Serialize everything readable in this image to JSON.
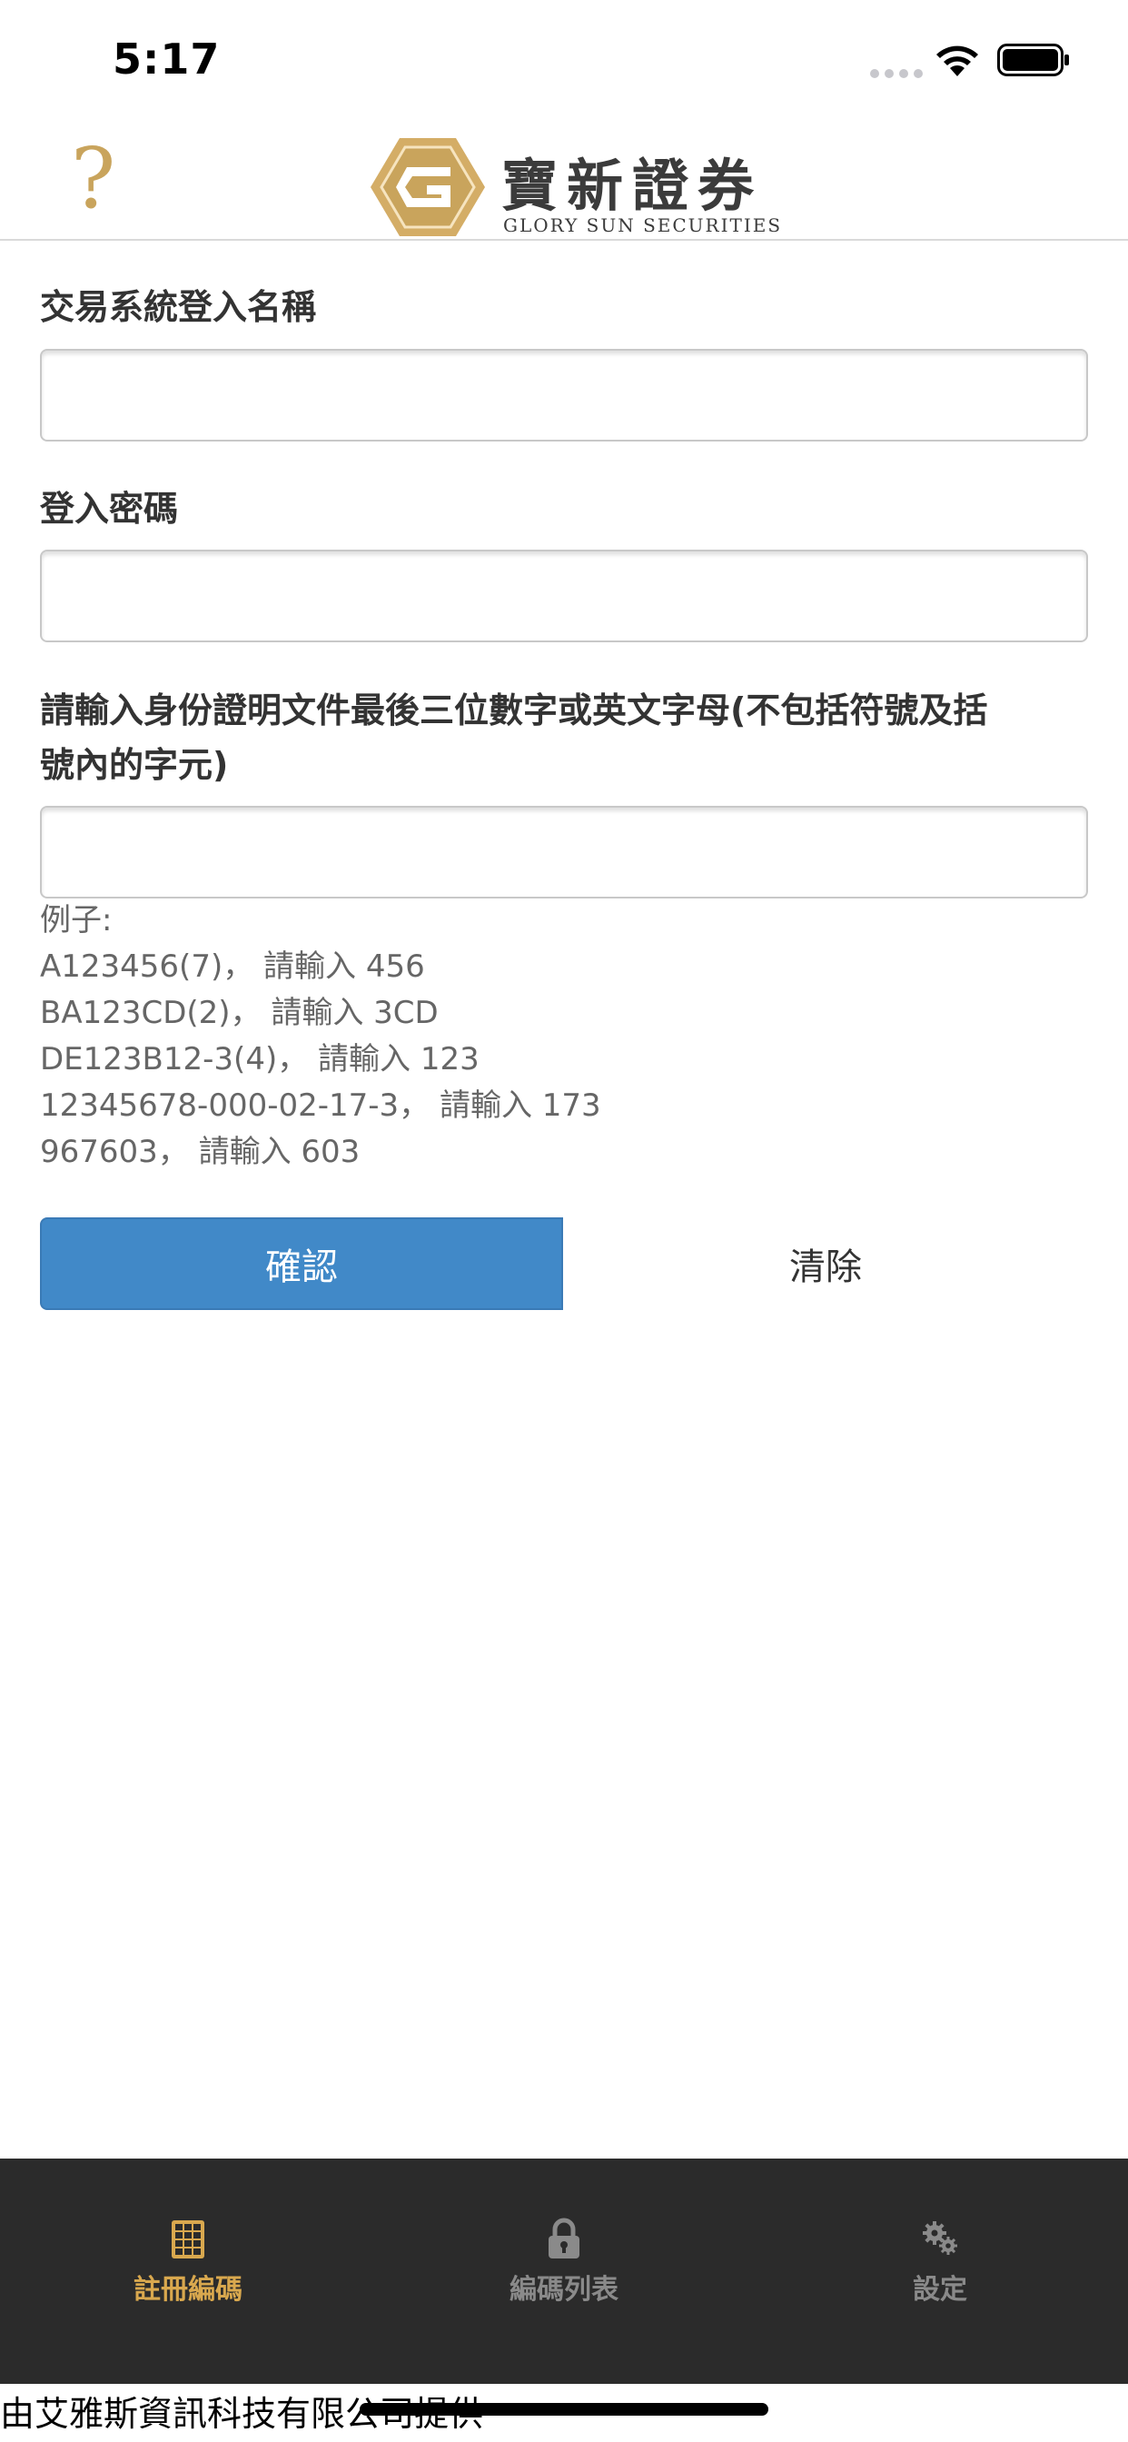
{
  "status_bar": {
    "time": "5:17"
  },
  "header": {
    "help_symbol": "?",
    "logo_cn": "寶新證券",
    "logo_en": "GLORY SUN SECURITIES",
    "logo_mark": "G"
  },
  "form": {
    "username_label": "交易系統登入名稱",
    "username_value": "",
    "password_label": "登入密碼",
    "password_value": "",
    "id_label_line1": "請輸入身份證明文件最後三位數字或英文字母(不包括符號及括",
    "id_label_line2": "號內的字元)",
    "id_value": "",
    "examples": [
      "例子:",
      "A123456(7)， 請輸入 456",
      "BA123CD(2)， 請輸入 3CD",
      "DE123B12-3(4)， 請輸入 123",
      "12345678-000-02-17-3， 請輸入 173",
      "967603， 請輸入 603"
    ],
    "confirm_label": "確認",
    "clear_label": "清除"
  },
  "tab_bar": {
    "tabs": [
      {
        "label": "註冊編碼",
        "icon": "keypad-icon",
        "active": true
      },
      {
        "label": "編碼列表",
        "icon": "lock-icon",
        "active": false
      },
      {
        "label": "設定",
        "icon": "gears-icon",
        "active": false
      }
    ]
  },
  "footer": {
    "text": "由艾雅斯資訊科技有限公司提供"
  },
  "colors": {
    "accent_gold": "#c9a45c",
    "button_blue": "#4189c8",
    "tab_bar_bg": "#2b2b2b",
    "tab_active": "#d9a84e"
  }
}
